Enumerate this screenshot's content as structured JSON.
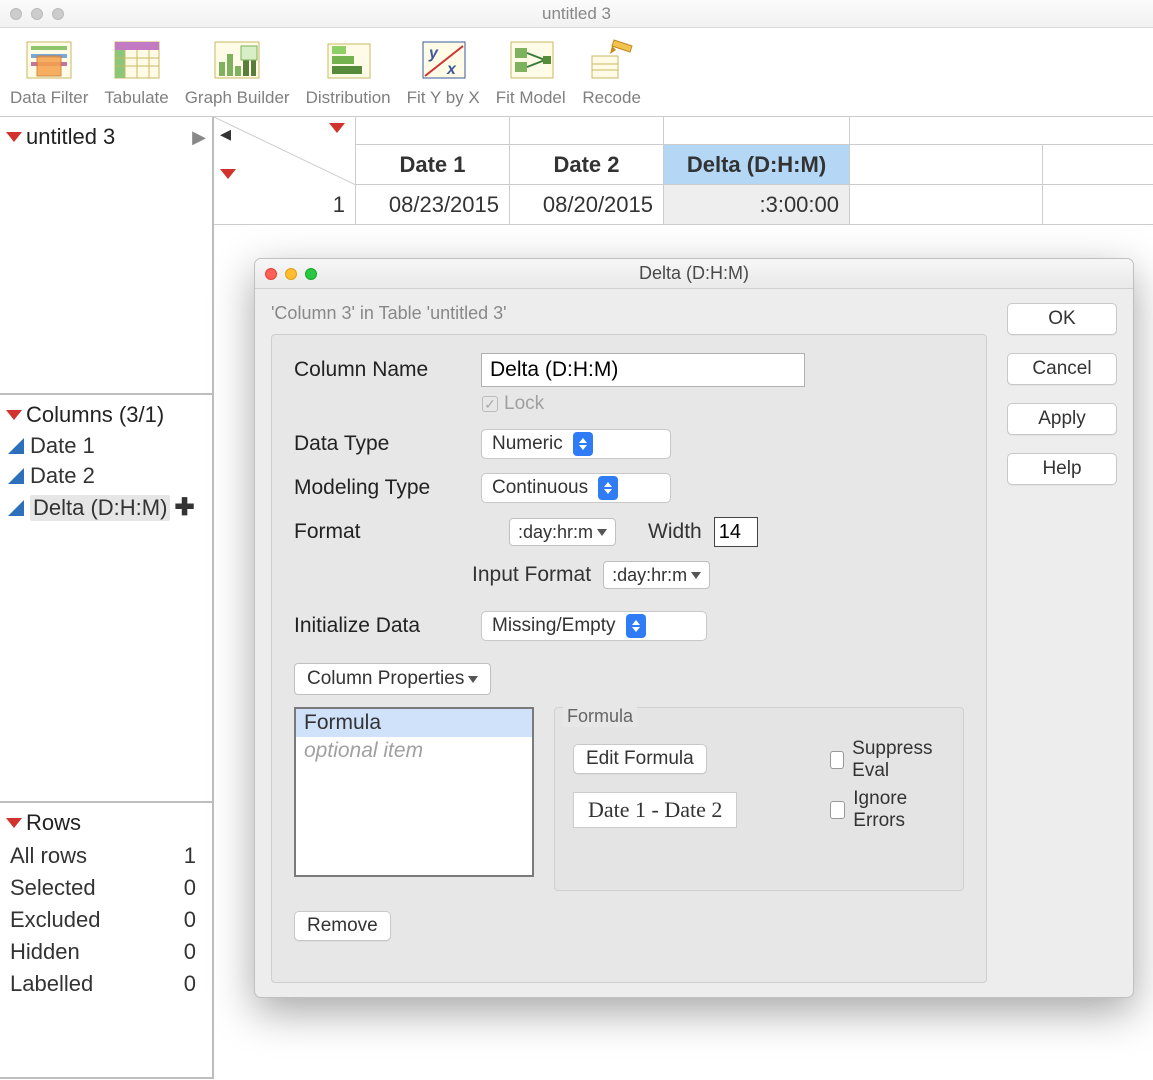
{
  "window": {
    "title": "untitled 3"
  },
  "toolbar": {
    "items": [
      {
        "label": "Data Filter"
      },
      {
        "label": "Tabulate"
      },
      {
        "label": "Graph Builder"
      },
      {
        "label": "Distribution"
      },
      {
        "label": "Fit Y by X"
      },
      {
        "label": "Fit Model"
      },
      {
        "label": "Recode"
      }
    ]
  },
  "sidepanel": {
    "tablename": "untitled 3",
    "columns_header": "Columns (3/1)",
    "columns": [
      {
        "name": "Date 1",
        "selected": false
      },
      {
        "name": "Date 2",
        "selected": false
      },
      {
        "name": "Delta (D:H:M)",
        "selected": true
      }
    ],
    "rows_header": "Rows",
    "row_stats": [
      {
        "label": "All rows",
        "value": "1"
      },
      {
        "label": "Selected",
        "value": "0"
      },
      {
        "label": "Excluded",
        "value": "0"
      },
      {
        "label": "Hidden",
        "value": "0"
      },
      {
        "label": "Labelled",
        "value": "0"
      }
    ]
  },
  "table": {
    "headers": [
      {
        "label": "Date 1",
        "selected": false
      },
      {
        "label": "Date 2",
        "selected": false
      },
      {
        "label": "Delta (D:H:M)",
        "selected": true
      }
    ],
    "row1": {
      "num": "1",
      "cells": [
        "08/23/2015",
        "08/20/2015",
        ":3:00:00"
      ]
    }
  },
  "dialog": {
    "title": "Delta (D:H:M)",
    "hint": "'Column 3' in Table 'untitled 3'",
    "buttons": {
      "ok": "OK",
      "cancel": "Cancel",
      "apply": "Apply",
      "help": "Help"
    },
    "labels": {
      "column_name": "Column Name",
      "lock": "Lock",
      "data_type": "Data Type",
      "modeling_type": "Modeling Type",
      "format": "Format",
      "width": "Width",
      "input_format": "Input Format",
      "initialize_data": "Initialize Data",
      "column_properties": "Column Properties",
      "formula_group": "Formula",
      "edit_formula": "Edit Formula",
      "suppress_eval": "Suppress Eval",
      "ignore_errors": "Ignore Errors",
      "remove": "Remove"
    },
    "values": {
      "column_name": "Delta (D:H:M)",
      "data_type": "Numeric",
      "modeling_type": "Continuous",
      "format": ":day:hr:m",
      "width": "14",
      "input_format": ":day:hr:m",
      "initialize_data": "Missing/Empty",
      "formula_expr": "Date 1 - Date 2"
    },
    "prop_list": {
      "selected": "Formula",
      "optional": "optional item"
    }
  }
}
